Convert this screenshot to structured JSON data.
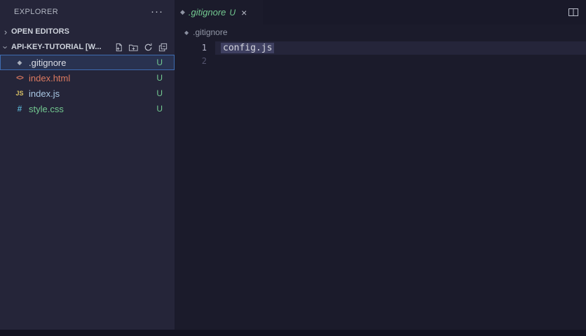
{
  "icons": {
    "more": "···",
    "chevron": "›",
    "close": "×",
    "gitignore_glyph": "◆",
    "html_glyph": "<>",
    "js_glyph": "JS",
    "css_glyph": "#",
    "breadcrumb_glyph": "◆"
  },
  "colors": {
    "selection_border": "#3e6bb0",
    "untracked_green": "#73c991",
    "html_orange": "#dd7a60",
    "js_yellow": "#d8c064",
    "css_blue": "#56a8c8",
    "sidebar_bg": "#252539",
    "editor_bg": "#1b1b2b",
    "tabbar_bg": "#191929"
  },
  "explorer": {
    "title": "EXPLORER",
    "open_editors_label": "OPEN EDITORS",
    "workspace_label": "API-KEY-TUTORIAL [W...",
    "files": [
      {
        "name": ".gitignore",
        "badge": "U"
      },
      {
        "name": "index.html",
        "badge": "U"
      },
      {
        "name": "index.js",
        "badge": "U"
      },
      {
        "name": "style.css",
        "badge": "U"
      }
    ]
  },
  "editor": {
    "tab": {
      "label": ".gitignore",
      "badge": "U"
    },
    "breadcrumb": ".gitignore",
    "lines": [
      {
        "number": "1",
        "code": "config.js"
      },
      {
        "number": "2",
        "code": ""
      }
    ]
  }
}
